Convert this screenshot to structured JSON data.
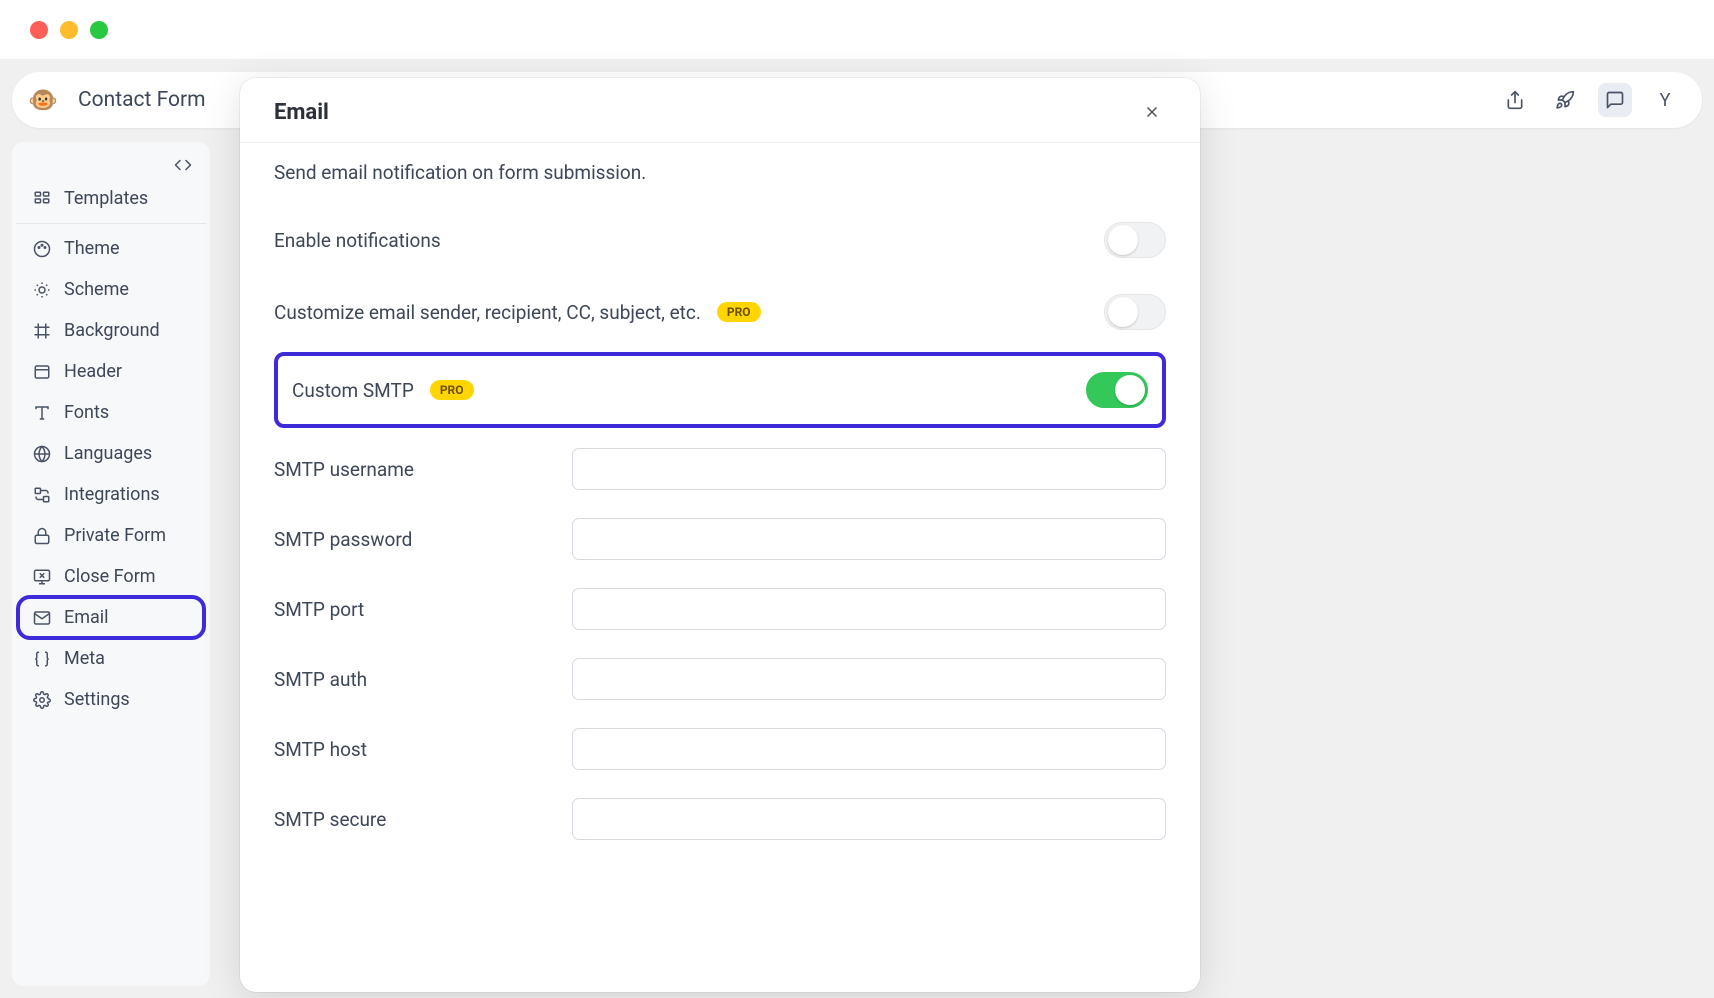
{
  "header": {
    "form_title": "Contact Form",
    "avatar_letter": "Y"
  },
  "sidebar": {
    "items": [
      {
        "label": "Templates",
        "icon": "templates"
      },
      {
        "label": "Theme",
        "icon": "palette"
      },
      {
        "label": "Scheme",
        "icon": "sun"
      },
      {
        "label": "Background",
        "icon": "frame"
      },
      {
        "label": "Header",
        "icon": "header"
      },
      {
        "label": "Fonts",
        "icon": "type"
      },
      {
        "label": "Languages",
        "icon": "globe"
      },
      {
        "label": "Integrations",
        "icon": "integrations"
      },
      {
        "label": "Private Form",
        "icon": "lock"
      },
      {
        "label": "Close Form",
        "icon": "monitor-x"
      },
      {
        "label": "Email",
        "icon": "mail"
      },
      {
        "label": "Meta",
        "icon": "braces"
      },
      {
        "label": "Settings",
        "icon": "gear"
      }
    ]
  },
  "modal": {
    "title": "Email",
    "subtitle": "Send email notification on form submission.",
    "enable_label": "Enable notifications",
    "customize_label": "Customize email sender, recipient, CC, subject, etc.",
    "custom_smtp_label": "Custom SMTP",
    "pro_badge": "PRO",
    "fields": {
      "username": "SMTP username",
      "password": "SMTP password",
      "port": "SMTP port",
      "auth": "SMTP auth",
      "host": "SMTP host",
      "secure": "SMTP secure"
    },
    "toggles": {
      "enable": false,
      "customize": false,
      "smtp": true
    }
  }
}
